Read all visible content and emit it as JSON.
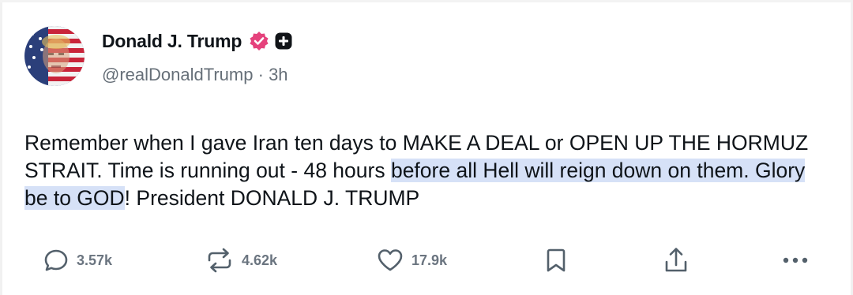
{
  "post": {
    "author": {
      "display_name": "Donald J. Trump",
      "handle": "@realDonaldTrump",
      "separator": "·",
      "time_ago": "3h",
      "avatar_icon": "flag-portrait-avatar",
      "verified_badge_color": "#e5427c"
    },
    "text": {
      "part1": "Remember when I gave Iran ten days to MAKE A DEAL or OPEN UP THE HORMUZ STRAIT. Time is running out - 48 hours ",
      "highlighted": "before all Hell will reign down on them. Glory be to GOD",
      "part2": "! President DONALD J. TRUMP",
      "highlight_color": "#d6e1f7"
    },
    "actions": {
      "replies": "3.57k",
      "reposts": "4.62k",
      "likes": "17.9k",
      "icons": [
        "reply-icon",
        "repost-icon",
        "like-icon",
        "bookmark-icon",
        "share-icon",
        "more-icon"
      ]
    }
  }
}
